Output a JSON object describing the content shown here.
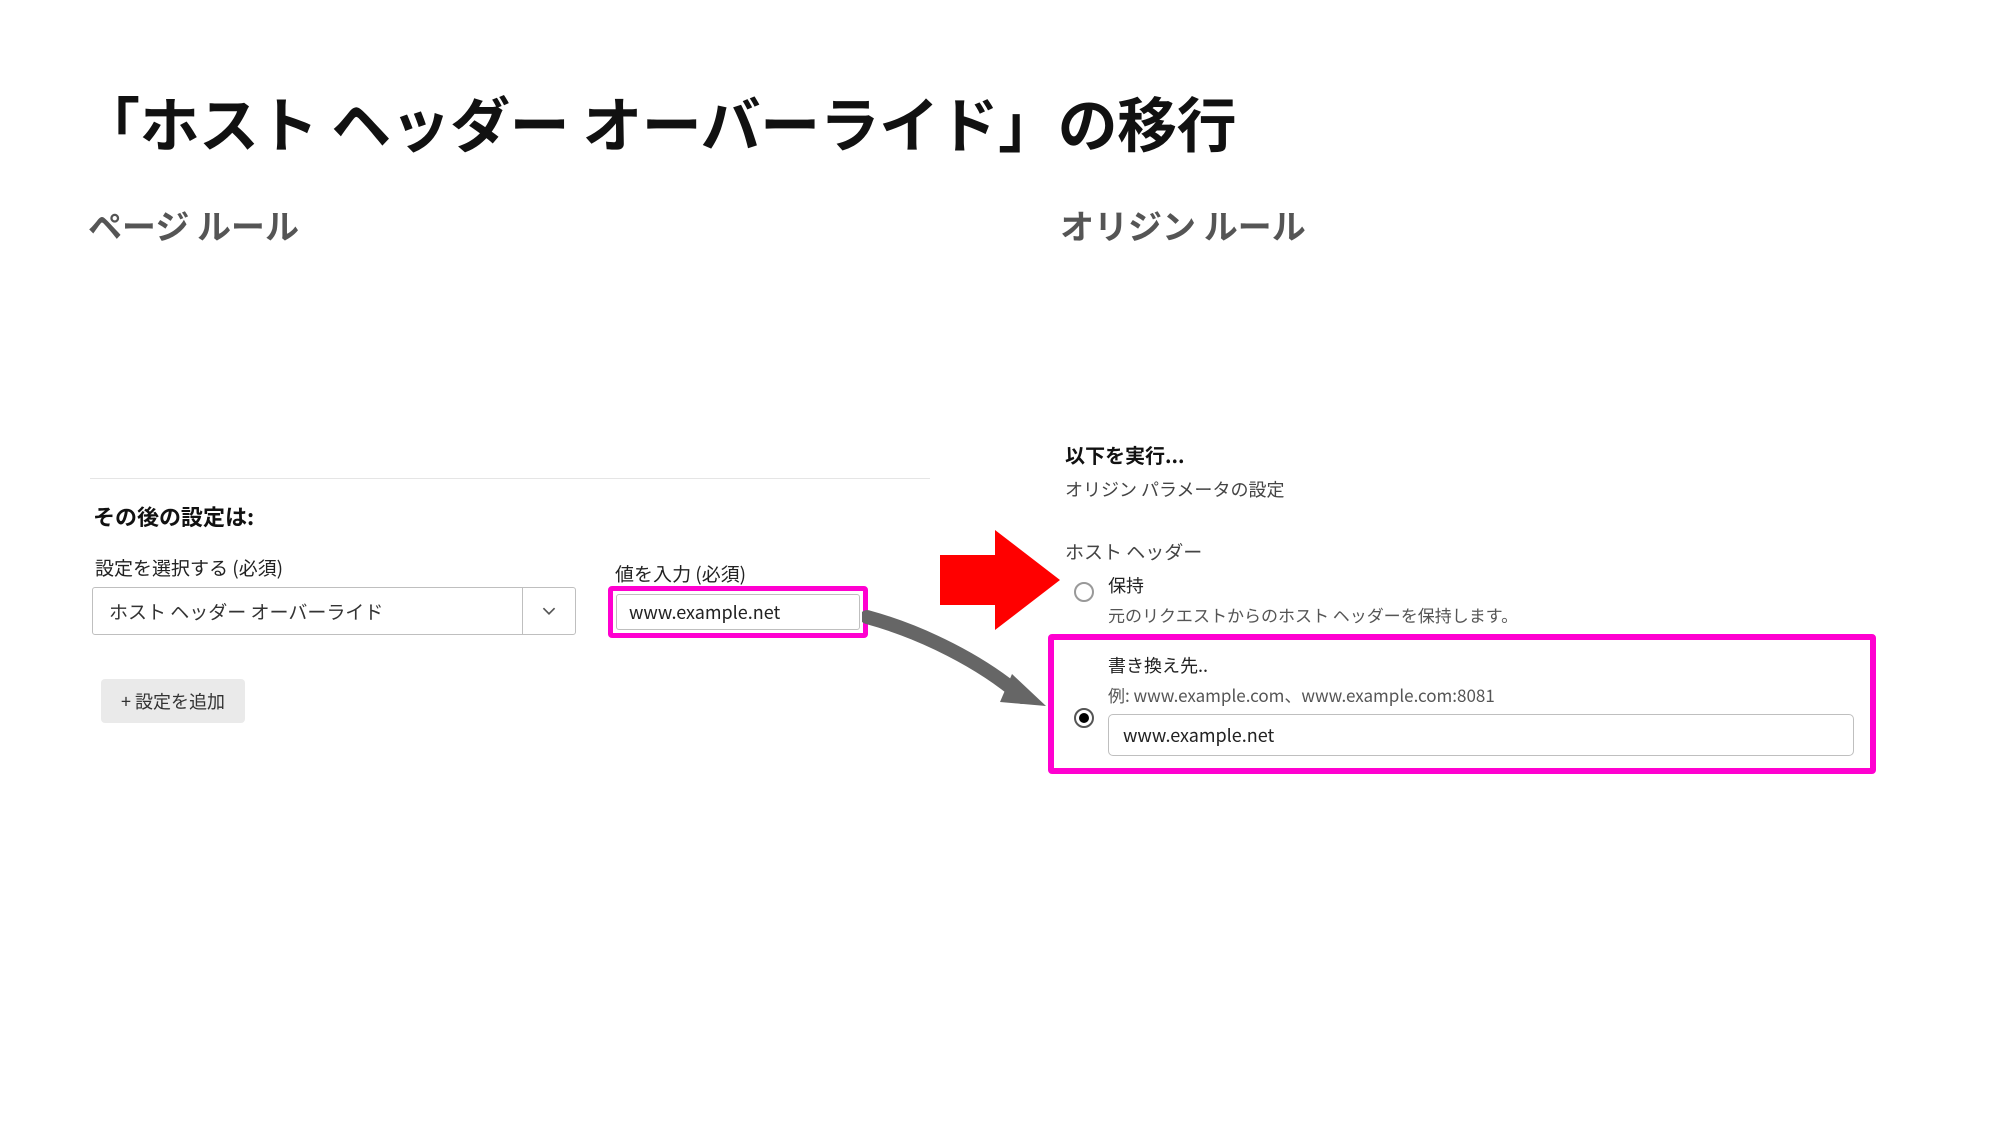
{
  "title": "「ホスト ヘッダー オーバーライド」の移行",
  "left_col_title": "ページ ルール",
  "right_col_title": "オリジン ルール",
  "page_rules": {
    "then_label": "その後の設定は:",
    "select_label": "設定を選択する (必須)",
    "select_value": "ホスト ヘッダー オーバーライド",
    "value_label": "値を入力 (必須)",
    "value_input": "www.example.net",
    "add_button": "+ 設定を追加"
  },
  "origin_rules": {
    "run_label": "以下を実行...",
    "subtitle": "オリジン パラメータの設定",
    "host_header_label": "ホスト ヘッダー",
    "keep_label": "保持",
    "keep_sub": "元のリクエストからのホスト ヘッダーを保持します。",
    "rewrite_label": "書き換え先..",
    "rewrite_example": "例: www.example.com、www.example.com:8081",
    "rewrite_value": "www.example.net"
  }
}
